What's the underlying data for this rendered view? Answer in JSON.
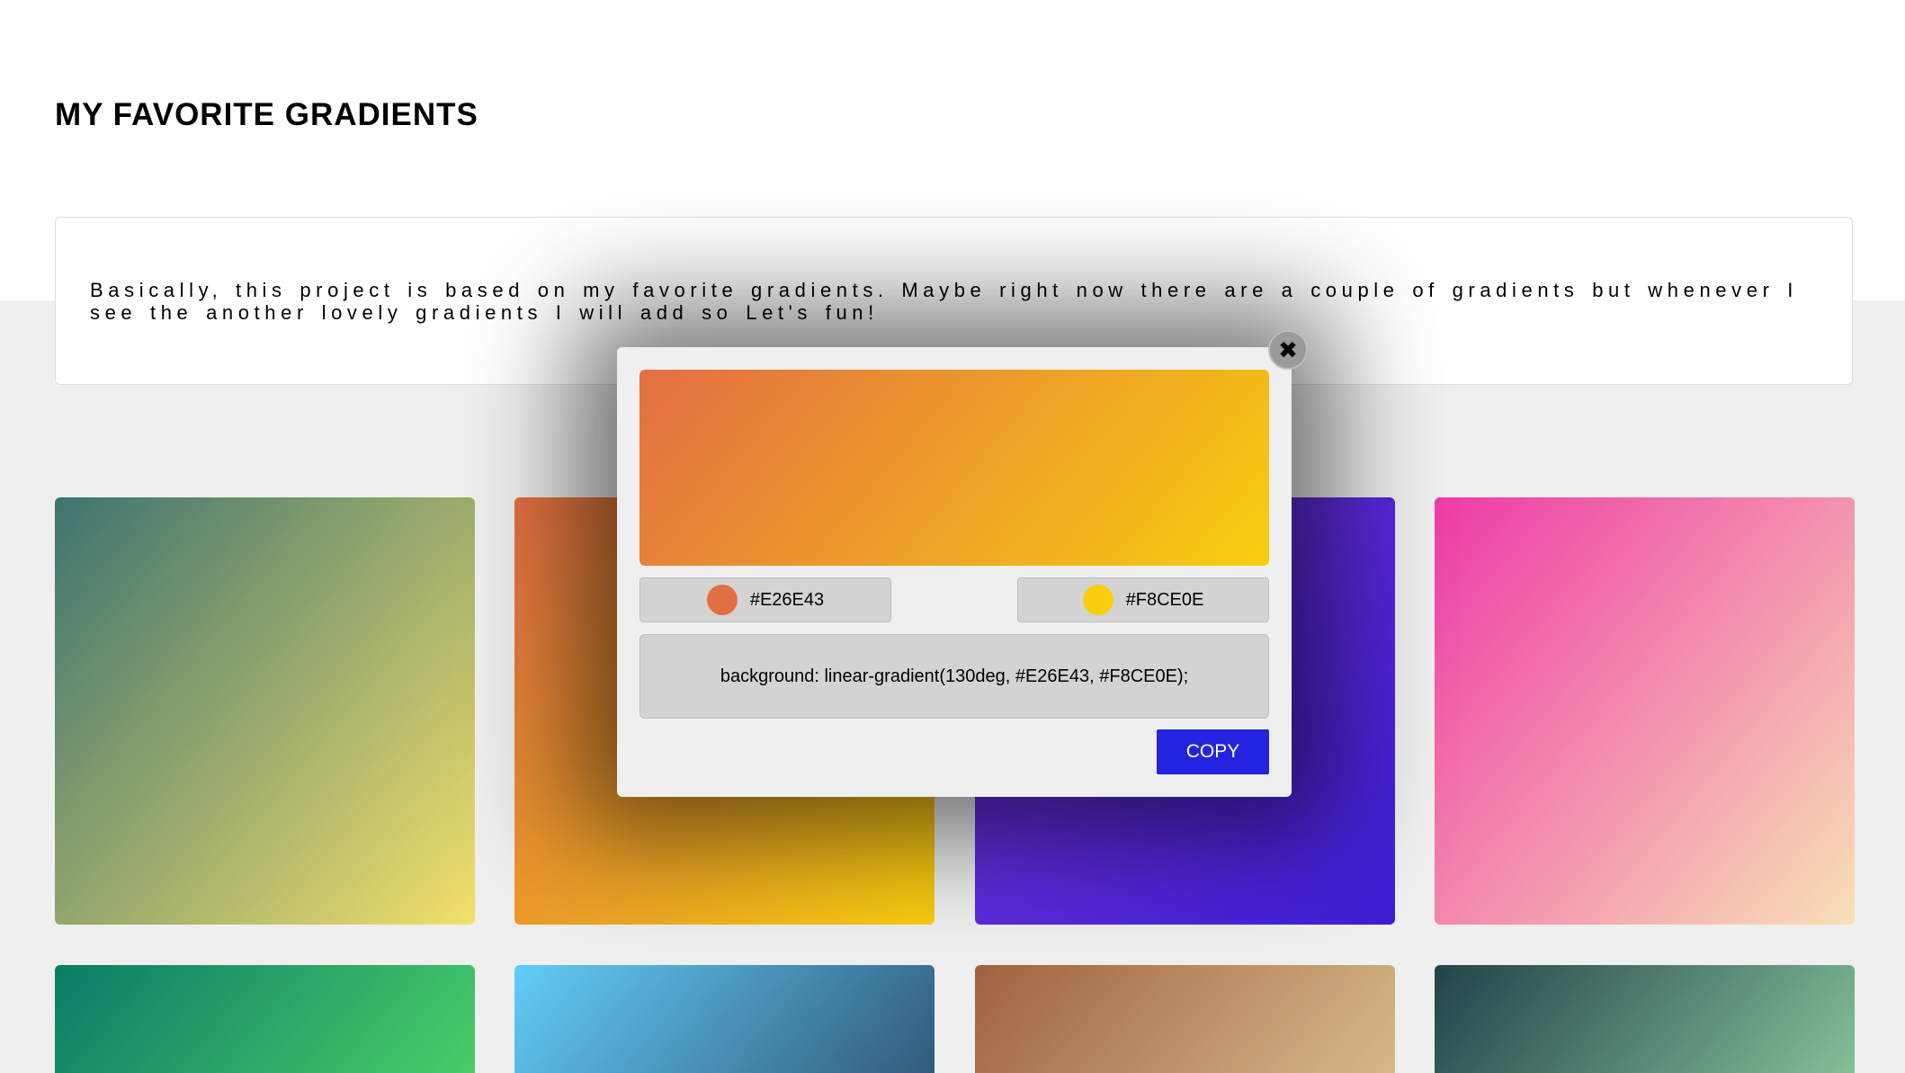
{
  "page": {
    "title": "MY FAVORITE GRADIENTS",
    "description": "Basically, this project is based on my favorite gradients. Maybe right now there are a couple of gradients but whenever I see the another lovely gradients I will add so Let's fun!"
  },
  "gradients": [
    {
      "angle": 130,
      "from": "#3E7370",
      "to": "#F2E06A"
    },
    {
      "angle": 130,
      "from": "#E26E43",
      "to": "#F8CE0E"
    },
    {
      "angle": 130,
      "from": "#7336E0",
      "to": "#3E1DD6"
    },
    {
      "angle": 130,
      "from": "#EE3BA6",
      "to": "#F8E0B6"
    },
    {
      "angle": 130,
      "from": "#0B7B68",
      "to": "#4AD068"
    },
    {
      "angle": 130,
      "from": "#62CCF8",
      "to": "#2F5878"
    },
    {
      "angle": 130,
      "from": "#A0623E",
      "to": "#D8BC8A"
    },
    {
      "angle": 130,
      "from": "#23424A",
      "to": "#86C39A"
    }
  ],
  "modal": {
    "close_glyph": "✖",
    "color_from": "#E26E43",
    "color_to": "#F8CE0E",
    "css_text": "background: linear-gradient(130deg, #E26E43, #F8CE0E);",
    "copy_label": "COPY"
  }
}
